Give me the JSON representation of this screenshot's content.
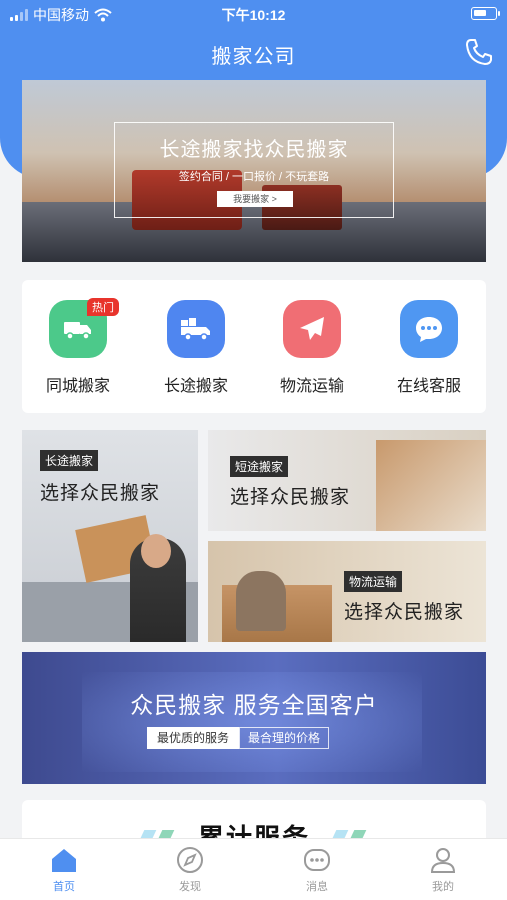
{
  "status_bar": {
    "carrier": "中国移动",
    "time": "下午10:12"
  },
  "nav": {
    "title": "搬家公司",
    "phone_icon": "phone-icon"
  },
  "banner": {
    "title": "长途搬家找众民搬家",
    "subtitle": "签约合同  /  一口报价  /  不玩套路",
    "button": "我要搬家 >"
  },
  "services": [
    {
      "label": "同城搬家",
      "icon": "truck-icon",
      "color": "#4cc98a",
      "badge": "热门"
    },
    {
      "label": "长途搬家",
      "icon": "delivery-truck-icon",
      "color": "#4f86f0"
    },
    {
      "label": "物流运输",
      "icon": "airplane-icon",
      "color": "#f06e74"
    },
    {
      "label": "在线客服",
      "icon": "chat-bubble-icon",
      "color": "#4f97f2"
    }
  ],
  "tiles": [
    {
      "tag": "长途搬家",
      "caption": "选择众民搬家"
    },
    {
      "tag": "短途搬家",
      "caption": "选择众民搬家"
    },
    {
      "tag": "物流运输",
      "caption": "选择众民搬家"
    }
  ],
  "promo": {
    "title": "众民搬家 服务全国客户",
    "pill1": "最优质的服务",
    "pill2": "最合理的价格"
  },
  "stats": {
    "title": "累计服务"
  },
  "tabbar": [
    {
      "label": "首页",
      "icon": "home-icon",
      "active": true
    },
    {
      "label": "发现",
      "icon": "compass-icon",
      "active": false
    },
    {
      "label": "消息",
      "icon": "message-icon",
      "active": false
    },
    {
      "label": "我的",
      "icon": "user-icon",
      "active": false
    }
  ],
  "colors": {
    "primary": "#4f8ff0",
    "hot_badge": "#e8342c"
  }
}
